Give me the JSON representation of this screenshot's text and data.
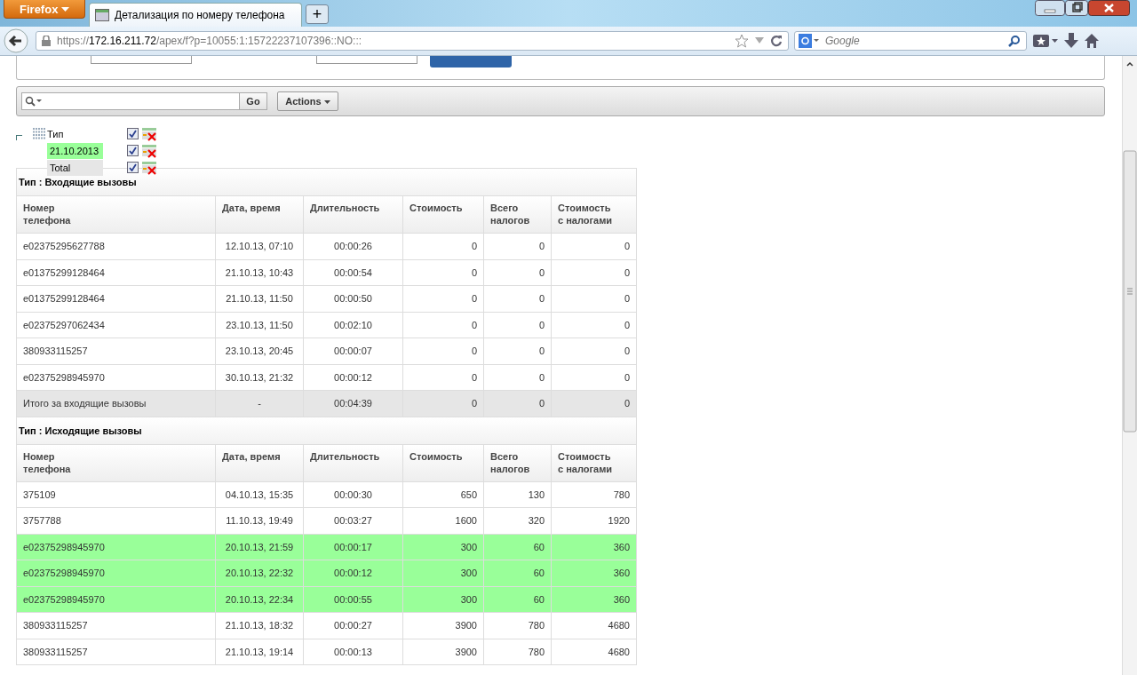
{
  "browser": {
    "menu_button": "Firefox",
    "tab_title": "Детализация по номеру телефона",
    "new_tab": "+",
    "url_scheme": "https://",
    "url_host": "172.16.211.72",
    "url_path": "/apex/f?p=10055:1:15722237107396::NO:::",
    "search_placeholder": "Google"
  },
  "toolbar": {
    "go_button": "Go",
    "actions_button": "Actions"
  },
  "filters": [
    {
      "label": "Тип",
      "checked": true,
      "kind": "group"
    },
    {
      "label": "21.10.2013",
      "checked": true,
      "kind": "highlight",
      "color": "#99ff99"
    },
    {
      "label": "Total",
      "checked": true,
      "kind": "highlight",
      "color": "#e6e6e6"
    }
  ],
  "groups": [
    {
      "title": "Тип : Входящие вызовы",
      "columns": [
        "Номер телефона",
        "Дата, время",
        "Длительность",
        "Стоимость",
        "Всего налогов",
        "Стоимость с налогами"
      ],
      "rows": [
        {
          "kind": "row",
          "highlighted": false,
          "cells": [
            "e02375295627788",
            "12.10.13, 07:10",
            "00:00:26",
            "0",
            "0",
            "0"
          ]
        },
        {
          "kind": "row",
          "highlighted": false,
          "cells": [
            "e01375299128464",
            "21.10.13, 10:43",
            "00:00:54",
            "0",
            "0",
            "0"
          ]
        },
        {
          "kind": "row",
          "highlighted": false,
          "cells": [
            "e01375299128464",
            "21.10.13, 11:50",
            "00:00:50",
            "0",
            "0",
            "0"
          ]
        },
        {
          "kind": "row",
          "highlighted": false,
          "cells": [
            "e02375297062434",
            "23.10.13, 11:50",
            "00:02:10",
            "0",
            "0",
            "0"
          ]
        },
        {
          "kind": "row",
          "highlighted": false,
          "cells": [
            "380933115257",
            "23.10.13, 20:45",
            "00:00:07",
            "0",
            "0",
            "0"
          ]
        },
        {
          "kind": "row",
          "highlighted": false,
          "cells": [
            "e02375298945970",
            "30.10.13, 21:32",
            "00:00:12",
            "0",
            "0",
            "0"
          ]
        },
        {
          "kind": "total",
          "cells": [
            "Итого за входящие вызовы",
            "-",
            "00:04:39",
            "0",
            "0",
            "0"
          ]
        }
      ]
    },
    {
      "title": "Тип : Исходящие вызовы",
      "columns": [
        "Номер телефона",
        "Дата, время",
        "Длительность",
        "Стоимость",
        "Всего налогов",
        "Стоимость с налогами"
      ],
      "rows": [
        {
          "kind": "row",
          "highlighted": false,
          "cells": [
            "375109",
            "04.10.13, 15:35",
            "00:00:30",
            "650",
            "130",
            "780"
          ]
        },
        {
          "kind": "row",
          "highlighted": false,
          "cells": [
            "3757788",
            "11.10.13, 19:49",
            "00:03:27",
            "1600",
            "320",
            "1920"
          ]
        },
        {
          "kind": "row",
          "highlighted": true,
          "cells": [
            "e02375298945970",
            "20.10.13, 21:59",
            "00:00:17",
            "300",
            "60",
            "360"
          ]
        },
        {
          "kind": "row",
          "highlighted": true,
          "cells": [
            "e02375298945970",
            "20.10.13, 22:32",
            "00:00:12",
            "300",
            "60",
            "360"
          ]
        },
        {
          "kind": "row",
          "highlighted": true,
          "cells": [
            "e02375298945970",
            "20.10.13, 22:34",
            "00:00:55",
            "300",
            "60",
            "360"
          ]
        },
        {
          "kind": "row",
          "highlighted": false,
          "cells": [
            "380933115257",
            "21.10.13, 18:32",
            "00:00:27",
            "3900",
            "780",
            "4680"
          ]
        },
        {
          "kind": "row",
          "highlighted": false,
          "cells": [
            "380933115257",
            "21.10.13, 19:14",
            "00:00:13",
            "3900",
            "780",
            "4680"
          ]
        }
      ]
    }
  ]
}
